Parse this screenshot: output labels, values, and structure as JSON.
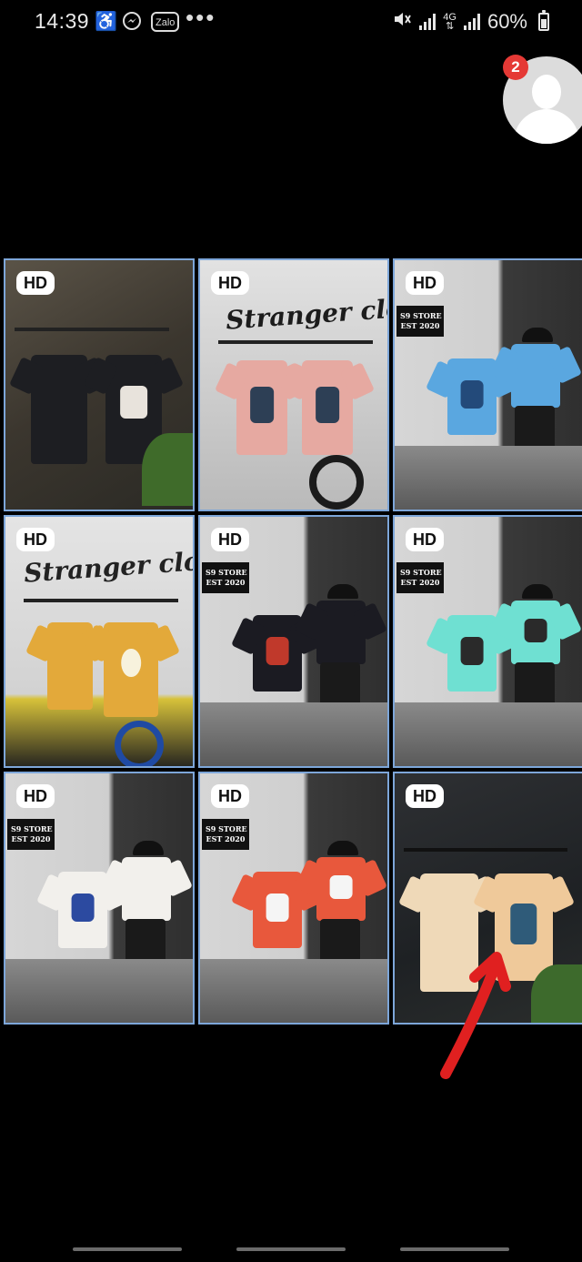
{
  "status_bar": {
    "time": "14:39",
    "zalo_label": "Zalo",
    "network_label": "4G",
    "battery": "60%",
    "battery_level": 0.6
  },
  "chat_head": {
    "unread_count": "2"
  },
  "gallery": {
    "items": [
      {
        "badge": "HD"
      },
      {
        "badge": "HD",
        "graffiti": "Stranger clothing"
      },
      {
        "badge": "HD",
        "sign": "S9 STORE\nEST 2020"
      },
      {
        "badge": "HD",
        "graffiti": "Stranger clothing"
      },
      {
        "badge": "HD",
        "sign": "S9 STORE\nEST 2020"
      },
      {
        "badge": "HD",
        "sign": "S9 STORE\nEST 2020"
      },
      {
        "badge": "HD",
        "sign": "S9 STORE\nEST 2020"
      },
      {
        "badge": "HD",
        "sign": "S9 STORE\nEST 2020"
      },
      {
        "badge": "HD"
      }
    ]
  },
  "colors": {
    "grid_border": "#7da6d9",
    "badge_red": "#e53935",
    "arrow_red": "#e02020"
  }
}
